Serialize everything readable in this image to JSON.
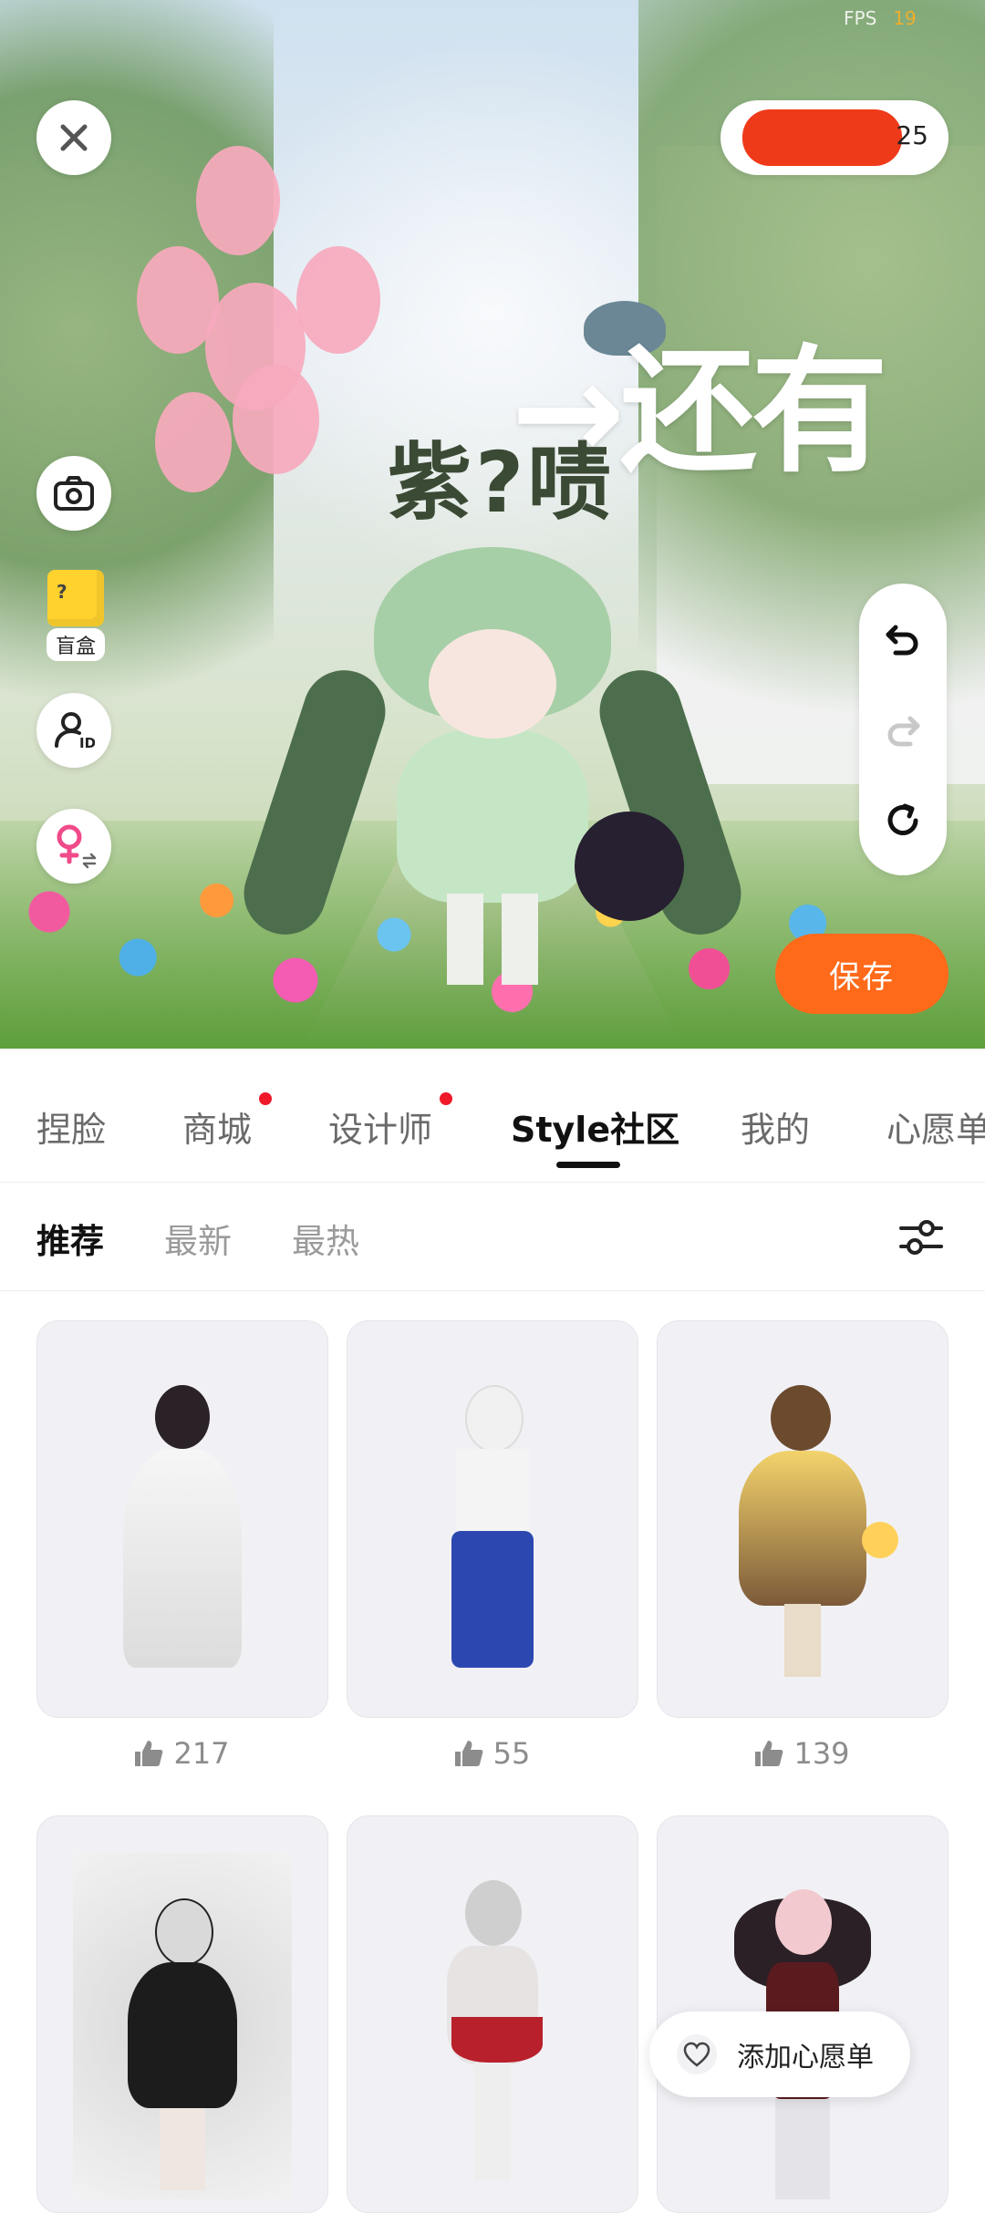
{
  "status": {
    "fps_label": "FPS",
    "fps_value": "19"
  },
  "scene": {
    "overlay_text": "→还有",
    "avatar_name": "紫?啧",
    "coins_value": "25",
    "blindbox_label": "盲盒",
    "save_label": "保存"
  },
  "main_tabs": [
    {
      "label": "捏脸",
      "active": false,
      "badge": false
    },
    {
      "label": "商城",
      "active": false,
      "badge": true
    },
    {
      "label": "设计师",
      "active": false,
      "badge": true
    },
    {
      "label": "Style社区",
      "active": true,
      "badge": false
    },
    {
      "label": "我的",
      "active": false,
      "badge": false
    },
    {
      "label": "心愿单",
      "active": false,
      "badge": false
    }
  ],
  "sub_tabs": [
    {
      "label": "推荐",
      "active": true
    },
    {
      "label": "最新",
      "active": false
    },
    {
      "label": "最热",
      "active": false
    }
  ],
  "outfits": [
    {
      "likes": "217"
    },
    {
      "likes": "55"
    },
    {
      "likes": "139"
    },
    {
      "likes": ""
    },
    {
      "likes": ""
    },
    {
      "likes": ""
    }
  ],
  "wishlist_button": {
    "label": "添加心愿单"
  },
  "icons": {
    "close": "close-icon",
    "camera": "camera-icon",
    "id": "id-profile-icon",
    "gender": "female-switch-icon",
    "undo": "undo-icon",
    "redo": "redo-icon",
    "reset": "reset-icon",
    "filter": "filter-sliders-icon",
    "like": "thumbs-up-icon",
    "heart": "heart-icon"
  },
  "colors": {
    "accent": "#ff6a1a",
    "badge": "#f0192a"
  }
}
